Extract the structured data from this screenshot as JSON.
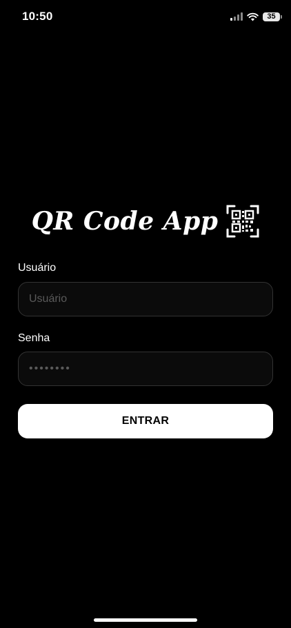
{
  "status_bar": {
    "time": "10:50",
    "battery": "35",
    "icons": [
      "signal-icon",
      "wifi-icon",
      "battery-icon"
    ]
  },
  "logo": {
    "title": "QR Code App",
    "icon": "qr-code-icon"
  },
  "form": {
    "username_label": "Usuário",
    "username_placeholder": "Usuário",
    "password_label": "Senha",
    "password_placeholder": "••••••••",
    "submit_label": "ENTRAR"
  },
  "colors": {
    "background": "#000000",
    "text": "#ffffff",
    "input_border": "#333333",
    "button_background": "#ffffff",
    "button_text": "#000000"
  }
}
